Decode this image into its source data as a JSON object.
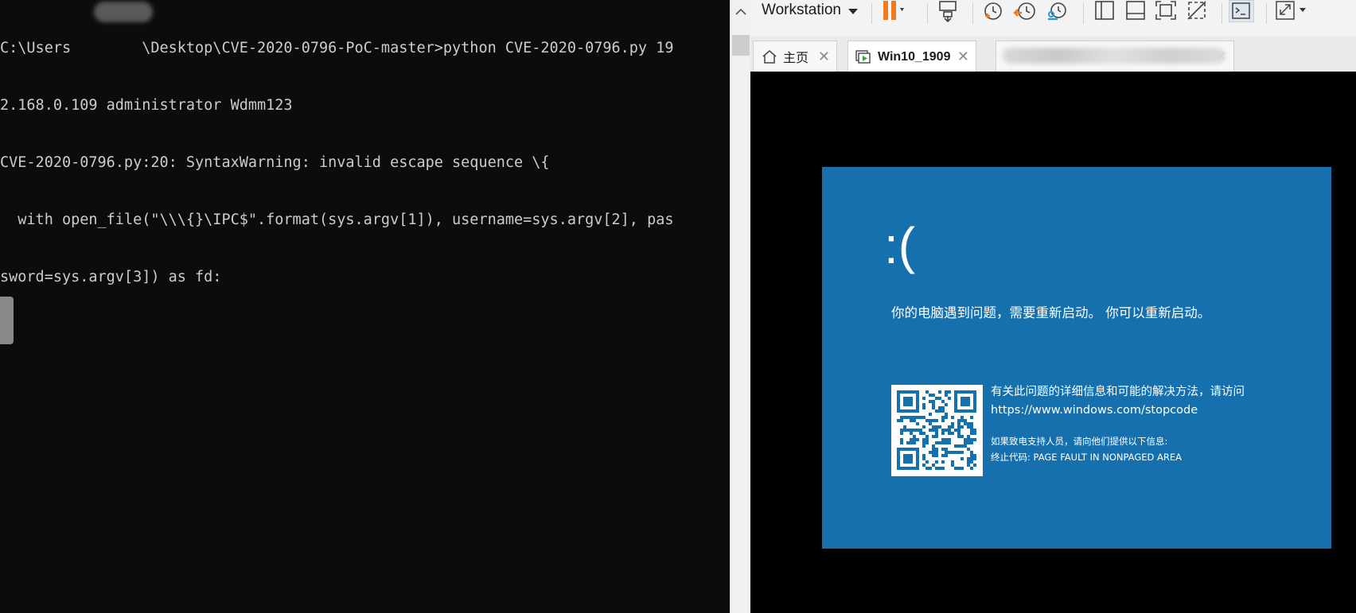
{
  "terminal": {
    "lines": [
      "C:\\Users        \\Desktop\\CVE-2020-0796-PoC-master>python CVE-2020-0796.py 19",
      "2.168.0.109 administrator Wdmm123",
      "CVE-2020-0796.py:20: SyntaxWarning: invalid escape sequence \\{",
      "  with open_file(\"\\\\\\{}\\IPC$\".format(sys.argv[1]), username=sys.argv[2], pas",
      "sword=sys.argv[3]) as fd:"
    ],
    "scrollbar": {
      "up_arrow": "^"
    }
  },
  "vmware": {
    "toolbar": {
      "workstation_label": "Workstation",
      "icons": [
        "pause-icon",
        "dropdown-icon",
        "send-ctrl-alt-del-icon",
        "snapshot-icon",
        "revert-snapshot-icon",
        "snapshot-manager-icon",
        "library-view-icon",
        "thumbnail-view-icon",
        "fullscreen-icon",
        "unity-icon",
        "console-icon",
        "stretch-icon"
      ]
    },
    "tabs": [
      {
        "label": "主页",
        "icon": "home-icon",
        "close": "✕"
      },
      {
        "label": "Win10_1909",
        "icon": "vm-running-icon",
        "close": "✕",
        "active": true
      },
      {
        "label": "",
        "blurred": true,
        "close": "✕"
      }
    ],
    "bsod": {
      "face": ":(",
      "message": "你的电脑遇到问题，需要重新启动。 你可以重新启动。",
      "info_line1": "有关此问题的详细信息和可能的解决方法，请访问",
      "info_line2": "https://www.windows.com/stopcode",
      "support_line": "如果致电支持人员，请向他们提供以下信息:",
      "stop_code": "终止代码: PAGE FAULT IN NONPAGED AREA",
      "background_color": "#1570ad"
    }
  }
}
